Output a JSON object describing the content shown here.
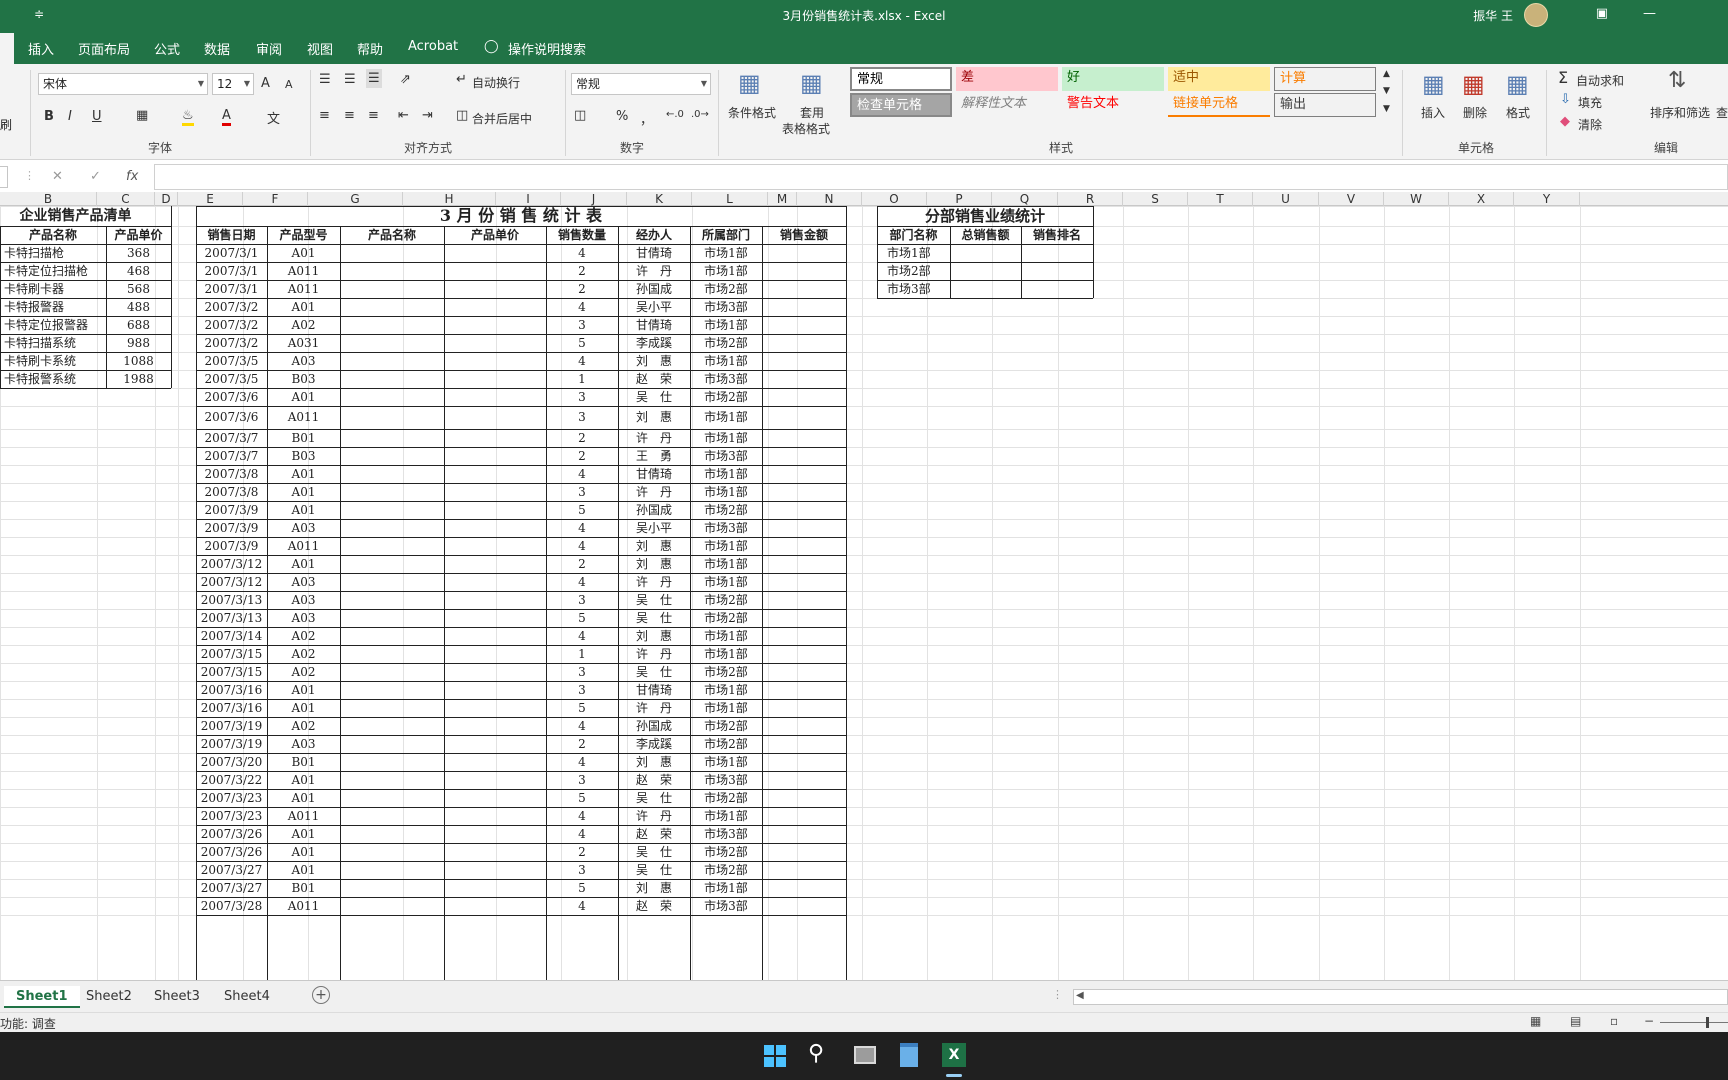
{
  "window": {
    "title": "3月份销售统计表.xlsx  -  Excel",
    "user": "振华 王",
    "qat": "≑"
  },
  "menu": [
    "插入",
    "页面布局",
    "公式",
    "数据",
    "审阅",
    "视图",
    "帮助",
    "Acrobat",
    "操作说明搜索"
  ],
  "ribbon": {
    "font": {
      "name": "宋体",
      "size": "12",
      "group_label": "字体",
      "bold": "B",
      "italic": "I",
      "underline": "U",
      "grow": "A",
      "shrink": "A"
    },
    "alignment": {
      "wrap": "自动换行",
      "merge": "合并后居中",
      "group_label": "对齐方式"
    },
    "number": {
      "format": "常规",
      "percent": "%",
      "comma": "，",
      "group_label": "数字"
    },
    "styles": {
      "conditional": "条件格式",
      "table_format_1": "套用",
      "table_format_2": "表格格式",
      "cells": [
        {
          "label": "常规",
          "bg": "#ffffff",
          "color": "#000000"
        },
        {
          "label": "差",
          "bg": "#ffc7ce",
          "color": "#9c0006"
        },
        {
          "label": "好",
          "bg": "#c6efce",
          "color": "#006100"
        },
        {
          "label": "适中",
          "bg": "#ffeb9c",
          "color": "#9c5700"
        },
        {
          "label": "计算",
          "bg": "#f2f2f2",
          "color": "#fa7d00"
        },
        {
          "label": "检查单元格",
          "bg": "#a5a5a5",
          "color": "#ffffff"
        },
        {
          "label": "解释性文本",
          "bg": "#f3f3f3",
          "color": "#7f7f7f"
        },
        {
          "label": "警告文本",
          "bg": "#f3f3f3",
          "color": "#ff0000"
        },
        {
          "label": "链接单元格",
          "bg": "#f3f3f3",
          "color": "#fa7d00"
        },
        {
          "label": "输出",
          "bg": "#f2f2f2",
          "color": "#3f3f3f"
        }
      ],
      "group_label": "样式"
    },
    "cells": {
      "insert": "插入",
      "delete": "删除",
      "format": "格式",
      "group_label": "单元格"
    },
    "editing": {
      "autosum": "自动求和",
      "fill": "填充",
      "clear": "清除",
      "sort": "排序和筛选",
      "find": "查",
      "group_label": "编辑"
    },
    "clipboard_frag": "刷"
  },
  "formula_bar": {
    "fx": "fx",
    "cancel": "✕",
    "enter": "✓",
    "value": ""
  },
  "columns": [
    "B",
    "C",
    "D",
    "E",
    "F",
    "G",
    "H",
    "I",
    "J",
    "K",
    "L",
    "M",
    "N",
    "O",
    "P",
    "Q",
    "R",
    "S",
    "T",
    "U",
    "V",
    "W",
    "X",
    "Y"
  ],
  "products": {
    "title": "企业销售产品清单",
    "headers": [
      "产品名称",
      "产品单价"
    ],
    "rows": [
      [
        "卡特扫描枪",
        "368"
      ],
      [
        "卡特定位扫描枪",
        "468"
      ],
      [
        "卡特刷卡器",
        "568"
      ],
      [
        "卡特报警器",
        "488"
      ],
      [
        "卡特定位报警器",
        "688"
      ],
      [
        "卡特扫描系统",
        "988"
      ],
      [
        "卡特刷卡系统",
        "1088"
      ],
      [
        "卡特报警系统",
        "1988"
      ]
    ]
  },
  "sales": {
    "title": "3 月 份 销 售 统 计 表",
    "headers": [
      "销售日期",
      "产品型号",
      "产品名称",
      "产品单价",
      "销售数量",
      "经办人",
      "所属部门",
      "销售金额"
    ],
    "rows": [
      [
        "2007/3/1",
        "A01",
        "4",
        "甘倩琦",
        "市场1部"
      ],
      [
        "2007/3/1",
        "A011",
        "2",
        "许　丹",
        "市场1部"
      ],
      [
        "2007/3/1",
        "A011",
        "2",
        "孙国成",
        "市场2部"
      ],
      [
        "2007/3/2",
        "A01",
        "4",
        "吴小平",
        "市场3部"
      ],
      [
        "2007/3/2",
        "A02",
        "3",
        "甘倩琦",
        "市场1部"
      ],
      [
        "2007/3/2",
        "A031",
        "5",
        "李成蹊",
        "市场2部"
      ],
      [
        "2007/3/5",
        "A03",
        "4",
        "刘　惠",
        "市场1部"
      ],
      [
        "2007/3/5",
        "B03",
        "1",
        "赵　荣",
        "市场3部"
      ],
      [
        "2007/3/6",
        "A01",
        "3",
        "吴　仕",
        "市场2部"
      ],
      [
        "2007/3/6",
        "A011",
        "3",
        "刘　惠",
        "市场1部"
      ],
      [
        "2007/3/7",
        "B01",
        "2",
        "许　丹",
        "市场1部"
      ],
      [
        "2007/3/7",
        "B03",
        "2",
        "王　勇",
        "市场3部"
      ],
      [
        "2007/3/8",
        "A01",
        "4",
        "甘倩琦",
        "市场1部"
      ],
      [
        "2007/3/8",
        "A01",
        "3",
        "许　丹",
        "市场1部"
      ],
      [
        "2007/3/9",
        "A01",
        "5",
        "孙国成",
        "市场2部"
      ],
      [
        "2007/3/9",
        "A03",
        "4",
        "吴小平",
        "市场3部"
      ],
      [
        "2007/3/9",
        "A011",
        "4",
        "刘　惠",
        "市场1部"
      ],
      [
        "2007/3/12",
        "A01",
        "2",
        "刘　惠",
        "市场1部"
      ],
      [
        "2007/3/12",
        "A03",
        "4",
        "许　丹",
        "市场1部"
      ],
      [
        "2007/3/13",
        "A03",
        "3",
        "吴　仕",
        "市场2部"
      ],
      [
        "2007/3/13",
        "A03",
        "5",
        "吴　仕",
        "市场2部"
      ],
      [
        "2007/3/14",
        "A02",
        "4",
        "刘　惠",
        "市场1部"
      ],
      [
        "2007/3/15",
        "A02",
        "1",
        "许　丹",
        "市场1部"
      ],
      [
        "2007/3/15",
        "A02",
        "3",
        "吴　仕",
        "市场2部"
      ],
      [
        "2007/3/16",
        "A01",
        "3",
        "甘倩琦",
        "市场1部"
      ],
      [
        "2007/3/16",
        "A01",
        "5",
        "许　丹",
        "市场1部"
      ],
      [
        "2007/3/19",
        "A02",
        "4",
        "孙国成",
        "市场2部"
      ],
      [
        "2007/3/19",
        "A03",
        "2",
        "李成蹊",
        "市场2部"
      ],
      [
        "2007/3/20",
        "B01",
        "4",
        "刘　惠",
        "市场1部"
      ],
      [
        "2007/3/22",
        "A01",
        "3",
        "赵　荣",
        "市场3部"
      ],
      [
        "2007/3/23",
        "A01",
        "5",
        "吴　仕",
        "市场2部"
      ],
      [
        "2007/3/23",
        "A011",
        "4",
        "许　丹",
        "市场1部"
      ],
      [
        "2007/3/26",
        "A01",
        "4",
        "赵　荣",
        "市场3部"
      ],
      [
        "2007/3/26",
        "A01",
        "2",
        "吴　仕",
        "市场2部"
      ],
      [
        "2007/3/27",
        "A01",
        "3",
        "吴　仕",
        "市场2部"
      ],
      [
        "2007/3/27",
        "B01",
        "5",
        "刘　惠",
        "市场1部"
      ],
      [
        "2007/3/28",
        "A011",
        "4",
        "赵　荣",
        "市场3部"
      ]
    ]
  },
  "dept": {
    "title": "分部销售业绩统计",
    "headers": [
      "部门名称",
      "总销售额",
      "销售排名"
    ],
    "rows": [
      "市场1部",
      "市场2部",
      "市场3部"
    ]
  },
  "sheets": [
    "Sheet1",
    "Sheet2",
    "Sheet3",
    "Sheet4"
  ],
  "status": {
    "text": "功能: 调查"
  }
}
